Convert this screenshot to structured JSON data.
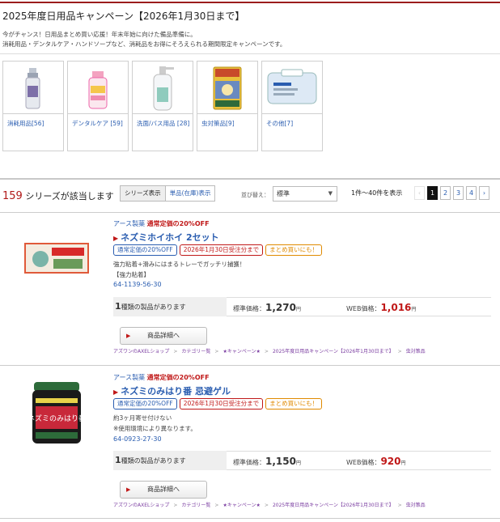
{
  "page": {
    "title": "2025年度日用品キャンペーン【2026年1月30日まで】",
    "intro_line1": "今がチャンス！日用品まとめ買い応援！年末年始に向けた備品準備に。",
    "intro_line2": "消耗用品・デンタルケア・ハンドソープなど、消耗品をお得にそろえられる期間限定キャンペーンです。"
  },
  "categories": [
    {
      "label": "消耗用品[56]",
      "icon": "spray-bottle-icon"
    },
    {
      "label": "デンタルケア [59]",
      "icon": "toothpaste-icon"
    },
    {
      "label": "洗面/バス用品 [28]",
      "icon": "soap-pump-icon"
    },
    {
      "label": "虫対策品[9]",
      "icon": "insect-trap-icon"
    },
    {
      "label": "その他[7]",
      "icon": "wet-wipes-icon"
    }
  ],
  "results": {
    "count": "159",
    "count_suffix": " シリーズが該当します",
    "tab_series": "シリーズ表示",
    "tab_single": "単品(在庫)表示",
    "sort_label": "並び替え：",
    "sort_value": "標準",
    "range": "1件～40件を表示",
    "pages": [
      "1",
      "2",
      "3",
      "4"
    ],
    "prev": "‹",
    "next": "›"
  },
  "products": [
    {
      "maker": "アース製薬",
      "discount": "通常定価の20%OFF",
      "name": "ネズミホイホイ 2セット",
      "badges": [
        "通常定価の20%OFF",
        "2026年1月30日受注分まで",
        "まとめ買いにも！"
      ],
      "desc1": "強力粘着+滑みにはまるトレーでガッチリ捕獲！",
      "desc2": "【強力粘着】",
      "code": "64-1139-56-30",
      "variants_count": "1",
      "variants_text": "種類の製品があります",
      "std_label": "標準価格：",
      "std_price": "1,270",
      "web_label": "WEB価格：",
      "web_price": "1,016",
      "yen": "円",
      "detail": "商品詳細へ",
      "crumbs": [
        "アズワンのAXELショップ",
        "カテゴリー覧",
        "★キャンペーン★",
        "2025年度日用品キャンペーン【2026年1月30日まで】",
        "虫対策品"
      ]
    },
    {
      "maker": "アース製薬",
      "discount": "通常定価の20%OFF",
      "name": "ネズミのみはり番 忌避ゲル",
      "badges": [
        "通常定価の20%OFF",
        "2026年1月30日受注分まで",
        "まとめ買いにも！"
      ],
      "desc1": "約3ヶ月寄せ付けない",
      "desc2": "※使用環境により異なります。",
      "code": "64-0923-27-30",
      "variants_count": "1",
      "variants_text": "種類の製品があります",
      "std_label": "標準価格：",
      "std_price": "1,150",
      "web_label": "WEB価格：",
      "web_price": "920",
      "yen": "円",
      "detail": "商品詳細へ",
      "crumbs": [
        "アズワンのAXELショップ",
        "カテゴリー覧",
        "★キャンペーン★",
        "2025年度日用品キャンペーン【2026年1月30日まで】",
        "虫対策品"
      ],
      "pkg_text": "ネズミのみはり番"
    }
  ],
  "colors": {
    "accent_red": "#c01818",
    "link_blue": "#2a5db0",
    "top_rule": "#9b1c1c"
  }
}
